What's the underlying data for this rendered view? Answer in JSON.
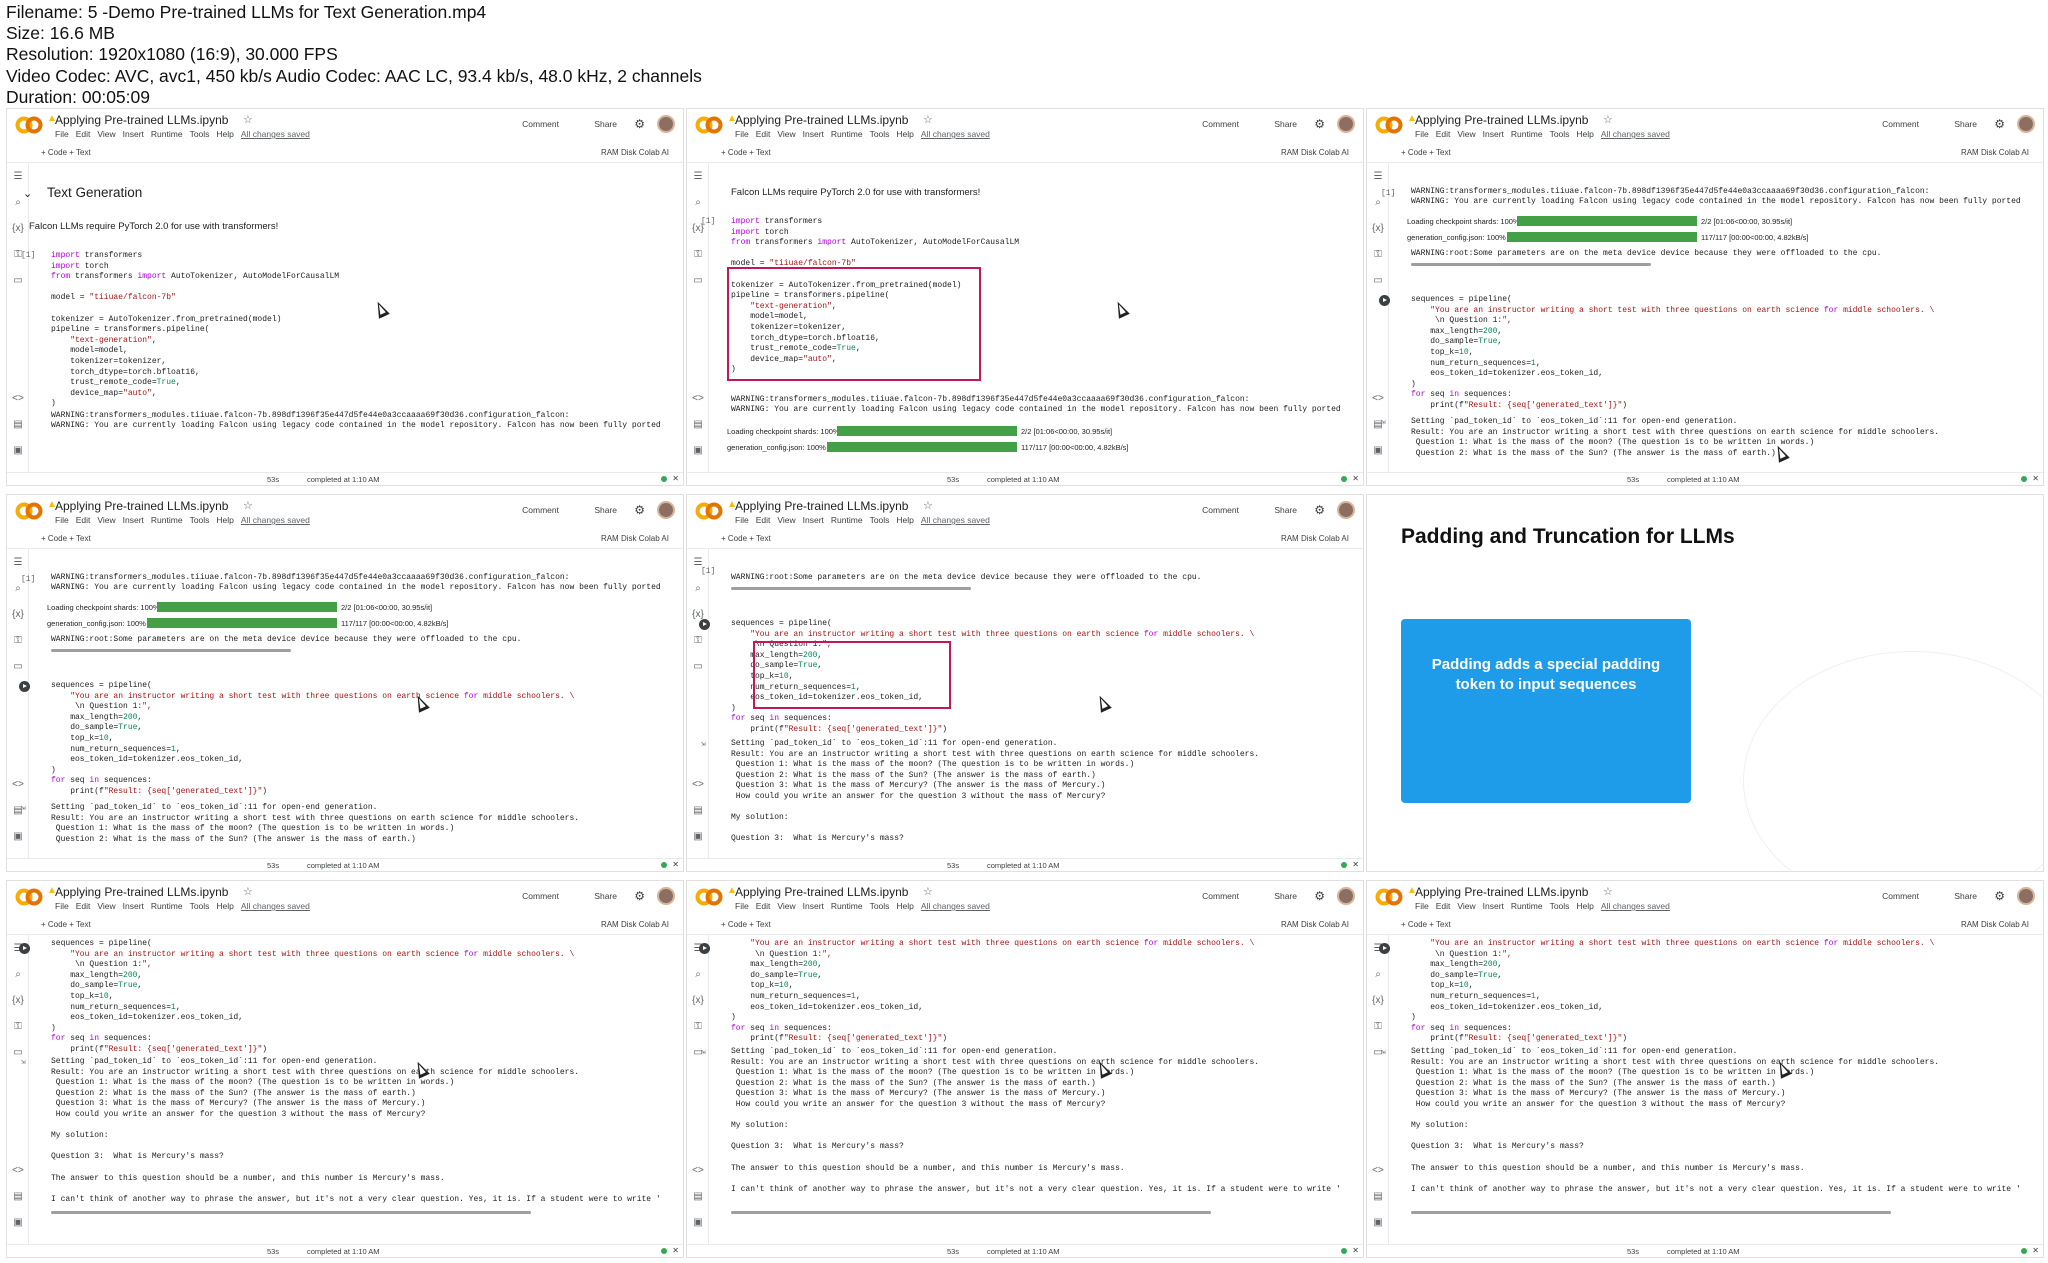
{
  "header": {
    "lines": [
      "Filename: 5 -Demo Pre-trained LLMs for Text Generation.mp4",
      "Size: 16.6 MB",
      "Resolution: 1920x1080 (16:9), 30.000 FPS",
      "Video Codec: AVC, avc1, 450 kb/s Audio Codec: AAC LC, 93.4 kb/s, 48.0 kHz, 2 channels",
      "Duration: 00:05:09"
    ]
  },
  "colab": {
    "logo": "CO",
    "notebook_title": "Applying Pre-trained LLMs.ipynb",
    "menu": [
      "File",
      "Edit",
      "View",
      "Insert",
      "Runtime",
      "Tools",
      "Help"
    ],
    "saved": "All changes saved",
    "comment": "Comment",
    "share": "Share",
    "code_btn": "+ Code",
    "text_btn": "+ Text",
    "ram": "RAM",
    "disk": "Disk",
    "colab_ai": "Colab AI",
    "status_time": "53s",
    "status_completed": "completed at 1:10 AM",
    "cell_num": "[1]",
    "icons": [
      "menu-icon",
      "search-icon",
      "variables-icon",
      "key-icon",
      "folder-icon",
      "code-icon",
      "terminal-icon",
      "form-icon"
    ]
  },
  "content": {
    "section_heading": "Text Generation",
    "falcon_note": "Falcon LLMs require PyTorch 2.0 for use with transformers!",
    "code1": [
      "import transformers",
      "import torch",
      "from transformers import AutoTokenizer, AutoModelForCausalLM",
      "",
      "model = \"tiiuae/falcon-7b\"",
      "",
      "tokenizer = AutoTokenizer.from_pretrained(model)",
      "pipeline = transformers.pipeline(",
      "    \"text-generation\",",
      "    model=model,",
      "    tokenizer=tokenizer,",
      "    torch_dtype=torch.bfloat16,",
      "    trust_remote_code=True,",
      "    device_map=\"auto\",",
      ")"
    ],
    "warn1": "WARNING:transformers_modules.tiiuae.falcon-7b.898df1396f35e447d5fe44e0a3ccaaaa69f30d36.configuration_falcon:",
    "warn2": "WARNING: You are currently loading Falcon using legacy code contained in the model repository. Falcon has now been fully ported",
    "shards_label": "Loading checkpoint shards: 100%",
    "shards_stat": "2/2 [01:06<00:00, 30.95s/it]",
    "gen_label": "generation_config.json: 100%",
    "gen_stat": "117/117 [00:00<00:00, 4.82kB/s]",
    "warn3": "WARNING:root:Some parameters are on the meta device device because they were offloaded to the cpu.",
    "code2": [
      "sequences = pipeline(",
      "    \"You are an instructor writing a short test with three questions on earth science for middle schoolers. \\",
      "     \\n Question 1:\",",
      "    max_length=200,",
      "    do_sample=True,",
      "    top_k=10,",
      "    num_return_sequences=1,",
      "    eos_token_id=tokenizer.eos_token_id,",
      ")",
      "for seq in sequences:",
      "    print(f\"Result: {seq['generated_text']}\")"
    ],
    "output": [
      "Setting `pad_token_id` to `eos_token_id`:11 for open-end generation.",
      "Result: You are an instructor writing a short test with three questions on earth science for middle schoolers.",
      " Question 1: What is the mass of the moon? (The question is to be written in words.)",
      " Question 2: What is the mass of the Sun? (The answer is the mass of earth.)",
      " Question 3: What is the mass of Mercury? (The answer is the mass of Mercury.)",
      " How could you write an answer for the question 3 without the mass of Mercury?",
      "",
      "My solution:",
      "",
      "Question 3:  What is Mercury's mass?",
      "",
      "The answer to this question should be a number, and this number is Mercury's mass.",
      "",
      "I can't think of another way to phrase the answer, but it's not a very clear question. Yes, it is. If a student were to write '"
    ]
  },
  "slide": {
    "title": "Padding and Truncation for LLMs",
    "box_text": "Padding adds a special padding token to input sequences"
  }
}
